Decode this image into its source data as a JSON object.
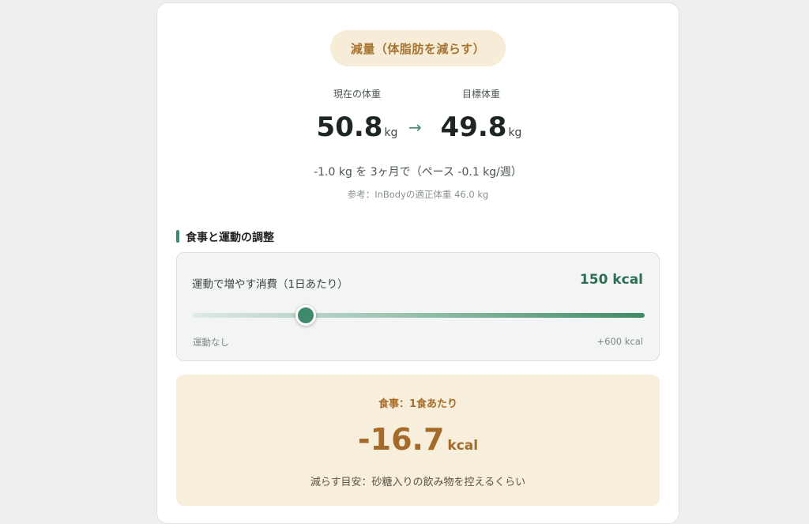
{
  "goal": {
    "label": "減量（体脂肪を減らす）"
  },
  "weights": {
    "current_label": "現在の体重",
    "current_value": "50.8",
    "target_label": "目標体重",
    "target_value": "49.8",
    "unit": "kg"
  },
  "pace": "-1.0 kg を 3ヶ月で（ペース -0.1 kg/週）",
  "reference": "参考：InBodyの適正体重 46.0 kg",
  "section": {
    "title": "食事と運動の調整"
  },
  "exercise": {
    "label": "運動で増やす消費（1日あたり）",
    "value_display": "150 kcal",
    "value": 150,
    "min": 0,
    "max": 600,
    "min_label": "運動なし",
    "max_label": "+600 kcal"
  },
  "meal": {
    "label": "食事：1食あたり",
    "value": "-16.7",
    "unit": "kcal",
    "hint": "減らす目安：砂糖入りの飲み物を控えるくらい"
  },
  "colors": {
    "accent": "#3e8a6b",
    "warm": "#a87432",
    "warm_bg": "#f7eedc"
  },
  "icons": {
    "arrow": "→"
  }
}
